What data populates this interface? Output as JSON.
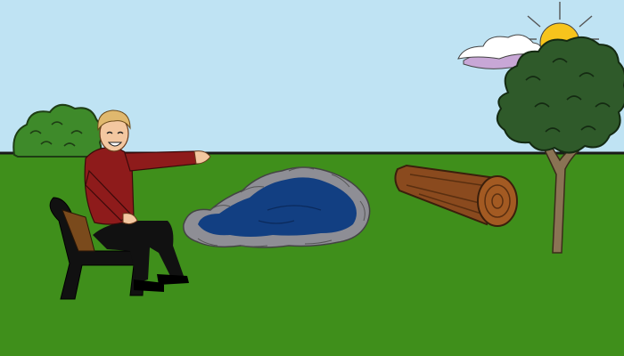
{
  "scene": {
    "kind": "cartoon park illustration",
    "colors": {
      "sky": "#bfe3f3",
      "grass": "#3f8f1b",
      "horizon_line": "#1a1a1a",
      "pond_water": "#123f82",
      "pond_stones": "#8e8e95",
      "log": "#8a4a1e",
      "shirt": "#8e1b1b",
      "pants": "#111111",
      "hair": "#e0b86e",
      "skin": "#f3c7a0",
      "bush": "#3e8a2a",
      "tree_foliage": "#2f5a2a",
      "tree_trunk": "#8a7354",
      "sun": "#f7c41c",
      "cloud": "#ffffff",
      "cloud_shadow": "#c8a7d6"
    },
    "objects": [
      {
        "name": "sky",
        "icon": "sky"
      },
      {
        "name": "sun",
        "icon": "sun-icon"
      },
      {
        "name": "cloud",
        "icon": "cloud-icon"
      },
      {
        "name": "grass-field",
        "icon": "grass"
      },
      {
        "name": "bush",
        "icon": "bush-icon"
      },
      {
        "name": "tree",
        "icon": "tree-icon"
      },
      {
        "name": "pond",
        "icon": "pond-icon"
      },
      {
        "name": "fallen-log",
        "icon": "log-icon"
      },
      {
        "name": "park-bench",
        "icon": "bench-icon"
      },
      {
        "name": "smiling-man-pointing",
        "icon": "person-icon"
      }
    ]
  }
}
